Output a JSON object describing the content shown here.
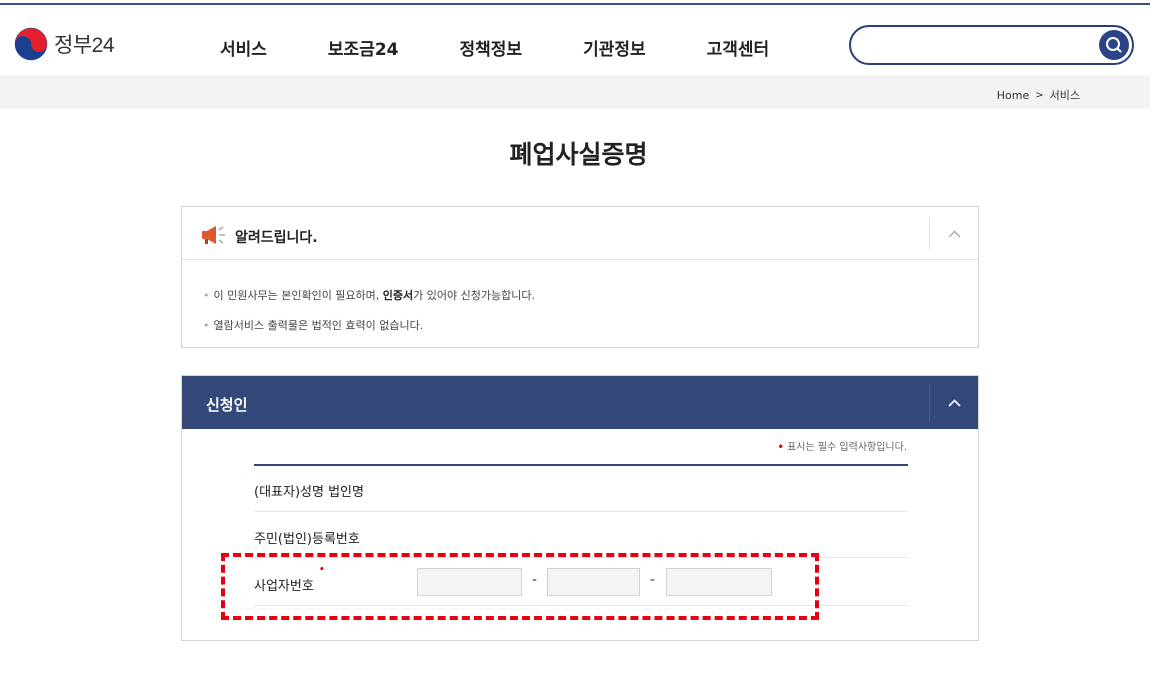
{
  "header": {
    "logo_text": "정부24",
    "nav": [
      "서비스",
      "보조금24",
      "정책정보",
      "기관정보",
      "고객센터"
    ],
    "search": {
      "value": "",
      "placeholder": ""
    }
  },
  "breadcrumb": {
    "home": "Home",
    "separator": ">",
    "current": "서비스"
  },
  "page_title": "폐업사실증명",
  "notice": {
    "title": "알려드립니다.",
    "line1_pre": "이 민원사무는 본인확인이 필요하며, ",
    "line1_bold": "인증서",
    "line1_post": "가 있어야 신청가능합니다.",
    "line2": "열람서비스 출력물은 법적인 효력이 없습니다."
  },
  "applicant": {
    "title": "신청인",
    "required_marker": "•",
    "required_note": "표시는 필수 입력사항입니다.",
    "rows": [
      {
        "label": "(대표자)성명 법인명"
      },
      {
        "label": "주민(법인)등록번호"
      },
      {
        "label": "사업자번호",
        "fields": [
          "",
          "",
          ""
        ],
        "separator": "-"
      }
    ]
  },
  "colors": {
    "brand_navy": "#34497a",
    "search_border": "#2a3d7c",
    "required_red": "#e60012",
    "highlight_red": "#e60012"
  },
  "icons": [
    "taegeuk-logo-icon",
    "search-icon",
    "megaphone-icon",
    "chevron-up-icon"
  ]
}
